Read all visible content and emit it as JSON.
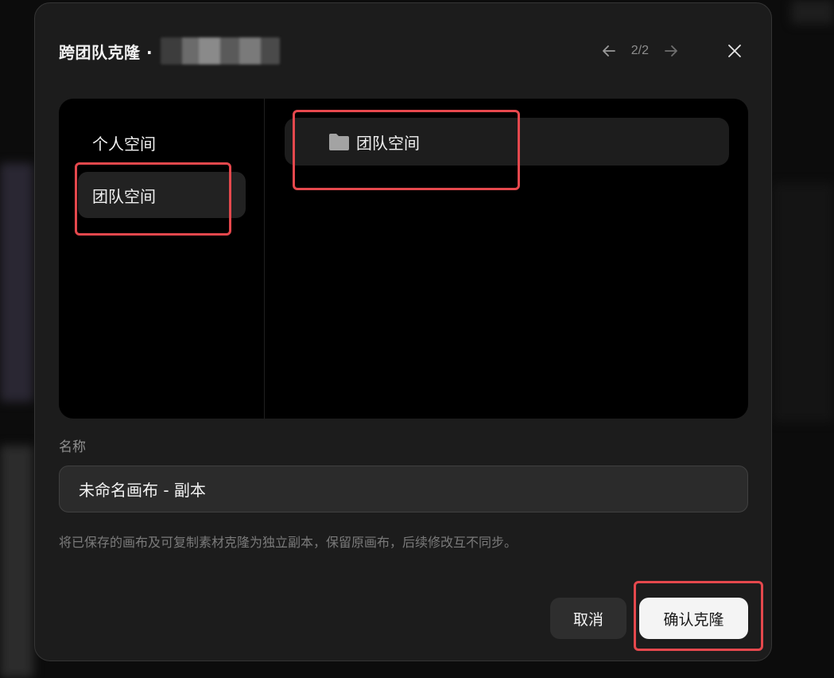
{
  "dialog": {
    "title": "跨团队克隆 ·",
    "nav": {
      "page_indicator": "2/2",
      "prev_icon": "arrow-left-icon",
      "next_icon": "arrow-right-icon"
    },
    "close_icon": "close-icon"
  },
  "sidebar": {
    "items": [
      {
        "label": "个人空间",
        "selected": false
      },
      {
        "label": "团队空间",
        "selected": true
      }
    ]
  },
  "folders": [
    {
      "label": "团队空间",
      "icon": "folder-icon"
    }
  ],
  "name_field": {
    "label": "名称",
    "value": "未命名画布 - 副本"
  },
  "hint": "将已保存的画布及可复制素材克隆为独立副本，保留原画布，后续修改互不同步。",
  "actions": {
    "cancel_label": "取消",
    "confirm_label": "确认克隆"
  },
  "colors": {
    "highlight": "#e5484d",
    "modal_bg": "#1c1c1c",
    "panel_bg": "#000000",
    "confirm_bg": "#f4f4f4"
  }
}
